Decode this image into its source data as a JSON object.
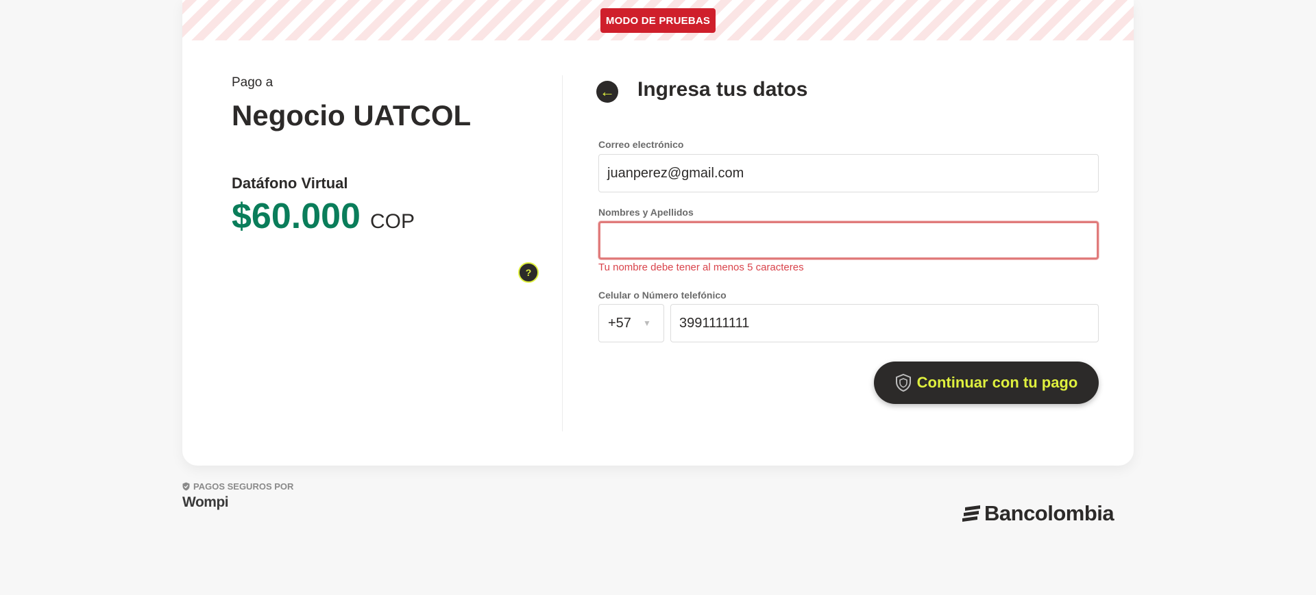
{
  "banner": {
    "test_mode_label": "MODO DE PRUEBAS"
  },
  "summary": {
    "pay_to_label": "Pago a",
    "merchant_name": "Negocio UATCOL",
    "product_name": "Datáfono Virtual",
    "amount": "$60.000",
    "currency": "COP",
    "help_icon": "question-icon"
  },
  "form": {
    "title": "Ingresa tus datos",
    "back_icon": "arrow-left-icon",
    "email": {
      "label": "Correo electrónico",
      "value": "juanperez@gmail.com"
    },
    "name": {
      "label": "Nombres y Apellidos",
      "value": "",
      "error": "Tu nombre debe tener al menos 5 caracteres"
    },
    "phone": {
      "label": "Celular o Número telefónico",
      "prefix": "+57",
      "value": "3991111111"
    },
    "submit_label": "Continuar con tu pago",
    "submit_icon": "shield-icon"
  },
  "footer": {
    "secure_label": "PAGOS SEGUROS POR",
    "provider_logo": "Wompi",
    "bank_logo": "Bancolombia"
  },
  "colors": {
    "accent_lime": "#dff03e",
    "dark": "#2c2a29",
    "amount_green": "#0a7d5a",
    "error_red": "#d9434b",
    "badge_red": "#cf1f2b"
  }
}
